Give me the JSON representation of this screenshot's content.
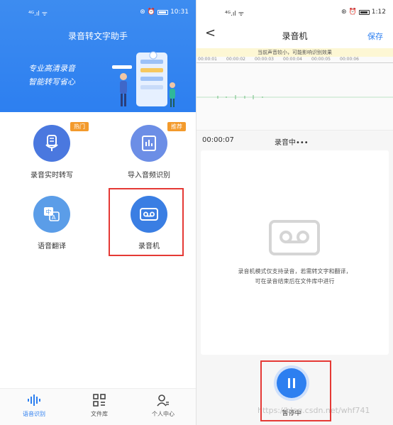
{
  "left": {
    "status": {
      "signal": "⁴ᴳ.ıl ᯤ",
      "time": "10:31"
    },
    "app_title": "录音转文字助手",
    "slogans": [
      "专业高清录音",
      "智能转写省心"
    ],
    "features": [
      {
        "label": "录音实时转写",
        "badge": "热门",
        "icon": "microphone-icon"
      },
      {
        "label": "导入音频识别",
        "badge": "推荐",
        "icon": "audio-file-icon"
      },
      {
        "label": "语音翻译",
        "icon": "translate-icon"
      },
      {
        "label": "录音机",
        "icon": "cassette-icon"
      }
    ],
    "tabs": [
      {
        "label": "语音识别",
        "icon": "waveform-icon",
        "active": true
      },
      {
        "label": "文件库",
        "icon": "grid-icon"
      },
      {
        "label": "个人中心",
        "icon": "user-icon"
      }
    ]
  },
  "right": {
    "status": {
      "signal": "⁴ᴳ.ıl ᯤ",
      "time": "1:12"
    },
    "back_label": "<",
    "title": "录音机",
    "save_label": "保存",
    "warning": "当前声音较小，可能影响识别效果",
    "ruler_ticks": [
      "00:00:01",
      "00:00:02",
      "00:00:03",
      "00:00:04",
      "00:00:05",
      "00:00:06"
    ],
    "elapsed": "00:00:07",
    "status_text": "录音中•••",
    "hint_line1": "录音机模式仅支持录音，若需转文字和翻译，",
    "hint_line2": "可在录音结束后在文件库中进行",
    "pause_label": "暂停中",
    "watermark": "https://blog.csdn.net/whf741"
  },
  "colors": {
    "primary": "#2d7ff0",
    "badge": "#f39a2c",
    "highlight": "#e53935"
  }
}
